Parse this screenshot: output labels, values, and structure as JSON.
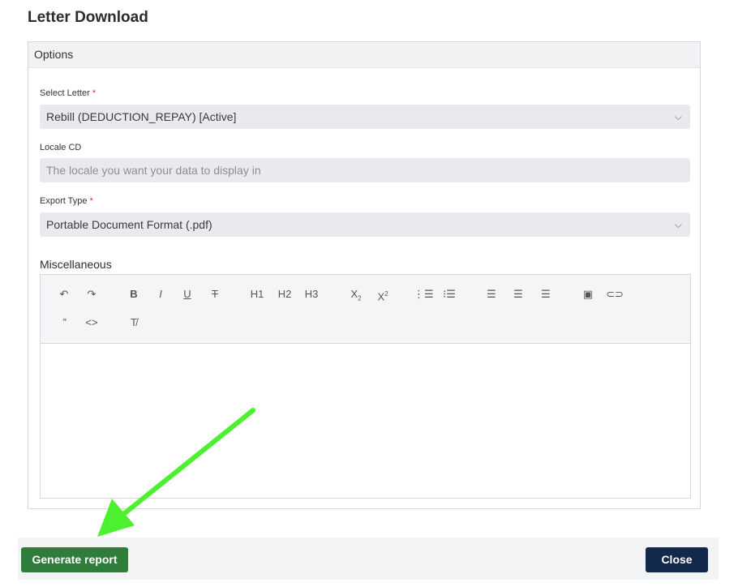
{
  "dialog": {
    "title": "Letter Download"
  },
  "panel": {
    "header": "Options"
  },
  "fields": {
    "select_letter": {
      "label": "Select Letter",
      "required_mark": "*",
      "value": "Rebill (DEDUCTION_REPAY) [Active]"
    },
    "locale_cd": {
      "label": "Locale CD",
      "placeholder": "The locale you want your data to display in"
    },
    "export_type": {
      "label": "Export Type",
      "required_mark": "*",
      "value": "Portable Document Format (.pdf)"
    }
  },
  "editor": {
    "label": "Miscellaneous",
    "toolbar": {
      "undo": "↶",
      "redo": "↷",
      "bold": "B",
      "italic": "I",
      "underline": "U",
      "strike": "T",
      "h1": "H1",
      "h2": "H2",
      "h3": "H3",
      "sub_base": "X",
      "sub_mark": "2",
      "sup_base": "X",
      "sup_mark": "2",
      "ordered_list": "⋮☰",
      "bullet_list": "⁝☰",
      "align_left": "☰",
      "align_center": "☰",
      "align_right": "☰",
      "image": "▣",
      "link": "⊂⊃",
      "quote": "”",
      "code": "<>",
      "clear_format": "T̸"
    },
    "content": ""
  },
  "footer": {
    "generate_label": "Generate report",
    "close_label": "Close"
  },
  "colors": {
    "accent_green": "#2e7d3a",
    "close_navy": "#13294b",
    "annotation_arrow": "#4cf02f"
  }
}
